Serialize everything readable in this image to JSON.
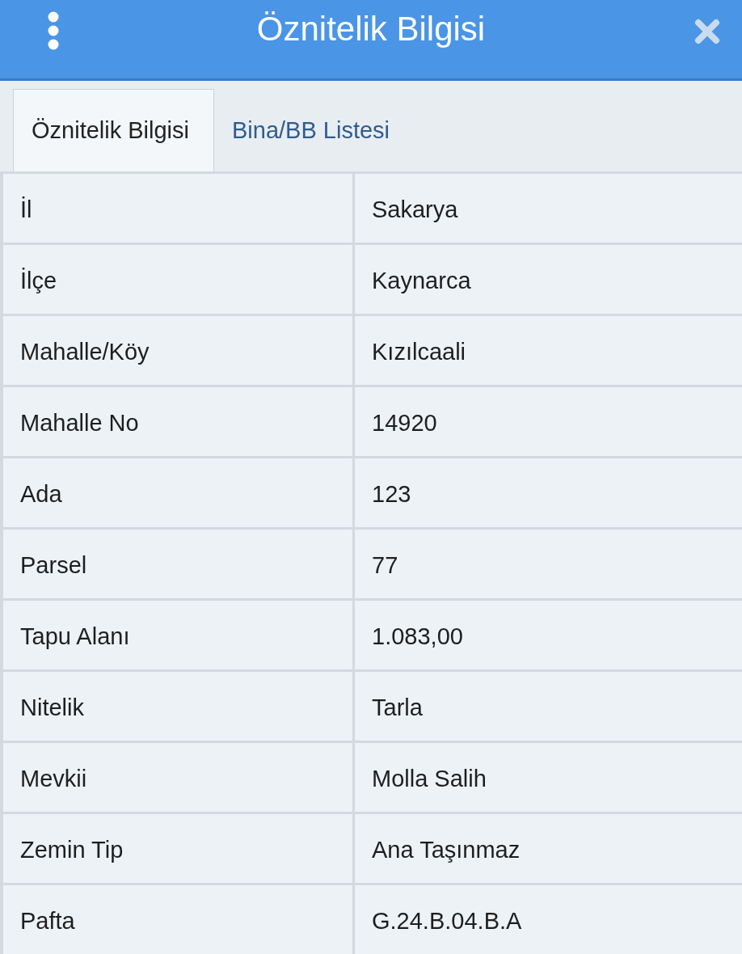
{
  "header": {
    "title": "Öznitelik Bilgisi"
  },
  "tabs": [
    {
      "label": "Öznitelik Bilgisi",
      "selected": true
    },
    {
      "label": "Bina/BB Listesi",
      "selected": false
    }
  ],
  "table": {
    "rows": [
      {
        "label": "İl",
        "value": "Sakarya"
      },
      {
        "label": "İlçe",
        "value": "Kaynarca"
      },
      {
        "label": "Mahalle/Köy",
        "value": "Kızılcaali"
      },
      {
        "label": "Mahalle No",
        "value": "14920"
      },
      {
        "label": "Ada",
        "value": "123"
      },
      {
        "label": "Parsel",
        "value": "77"
      },
      {
        "label": "Tapu Alanı",
        "value": "1.083,00"
      },
      {
        "label": "Nitelik",
        "value": "Tarla"
      },
      {
        "label": "Mevkii",
        "value": "Molla Salih"
      },
      {
        "label": "Zemin Tip",
        "value": "Ana Taşınmaz"
      },
      {
        "label": "Pafta",
        "value": "G.24.B.04.B.A"
      }
    ]
  }
}
